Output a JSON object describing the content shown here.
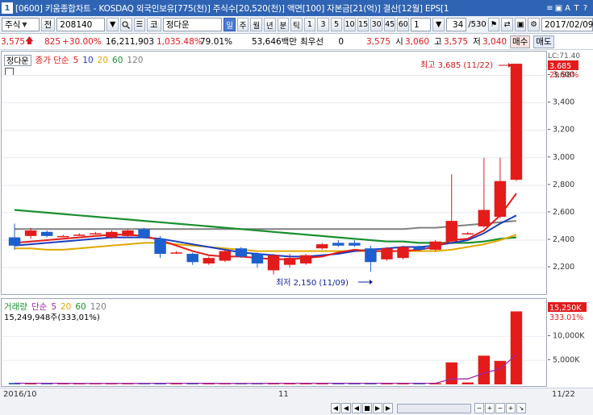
{
  "titlebar": {
    "window_number": "1",
    "title": "[0600] 키움종합차트 - KOSDAQ 외국인보유[775(천)] 주식수[20,520(천)] 액면[100] 자본금[21(억)] 결산[12월] EPS[1",
    "icons": [
      "menu-icon",
      "save-icon",
      "font-icon",
      "tool-icon",
      "help-icon"
    ],
    "icon_glyphs": [
      "≡",
      "▣",
      "A",
      "T",
      "?"
    ]
  },
  "toolbar": {
    "type_select": "주식",
    "prefix_btn": "전",
    "code": "208140",
    "market_btn": "코",
    "stock_name": "정다운",
    "periods": [
      "일",
      "주",
      "월",
      "년",
      "분",
      "틱"
    ],
    "period_active": "일",
    "nums": [
      "1",
      "3",
      "5",
      "10",
      "15",
      "30",
      "45",
      "60"
    ],
    "interval_value": "1",
    "page_counter": "34",
    "page_total": "/530",
    "date": "2017/02/09"
  },
  "infobar": {
    "price": "3,575",
    "change": "825",
    "change_rate": "+30.00%",
    "volume": "16,211,903",
    "volume_rate": "1,035.48%",
    "turnover": "79.01%",
    "amount": "53,646백만",
    "seller_label": "최우선",
    "seller_value": "0",
    "price2": "3,575",
    "open_label": "시",
    "open": "3,060",
    "high_label": "고",
    "high": "3,575",
    "low_label": "저",
    "low": "3,040",
    "buy_button": "매수",
    "sell_button": "매도"
  },
  "price_pane": {
    "name_button": "정다운",
    "legend_label": "종가 단순",
    "ma_periods": [
      "5",
      "10",
      "20",
      "60",
      "120"
    ],
    "ma_colors": [
      "#e31b1b",
      "#1c3fbf",
      "#e0a800",
      "#1a8f2e",
      "#808080"
    ],
    "high_annotation": "최고 3,685 (11/22)",
    "low_annotation": "최저 2,150 (11/09)",
    "last_price_tag": "3,685",
    "last_rate_tag": "29.98%",
    "axis_top_label": "LC:71.40"
  },
  "volume_pane": {
    "legend_label": "거래량",
    "legend_label2": "단순",
    "ma_periods": [
      "5",
      "20",
      "60",
      "120"
    ],
    "ma_colors": [
      "#9b2aa8",
      "#e0a800",
      "#1a8f2e",
      "#808080"
    ],
    "volume_text": "15,249,948주(333,01%)",
    "last_volume_tag": "15,250K",
    "last_volume_rate": "333.01%"
  },
  "date_labels": [
    "2016/10",
    "11",
    "11/22"
  ],
  "chart_data": {
    "type": "candlestick",
    "price_axis_ticks": [
      2200,
      2400,
      2600,
      2800,
      3000,
      3200,
      3400,
      3600
    ],
    "price_axis_labels": [
      "2,200",
      "2,400",
      "2,600",
      "2,800",
      "3,000",
      "3,200",
      "3,400",
      "3,600"
    ],
    "ylim": [
      2030,
      3750
    ],
    "candles": [
      {
        "o": 2420,
        "c": 2360,
        "h": 2520,
        "l": 2330
      },
      {
        "o": 2430,
        "c": 2470,
        "h": 2490,
        "l": 2410
      },
      {
        "o": 2460,
        "c": 2430,
        "h": 2470,
        "l": 2420
      },
      {
        "o": 2430,
        "c": 2430,
        "h": 2440,
        "l": 2420
      },
      {
        "o": 2440,
        "c": 2440,
        "h": 2450,
        "l": 2430
      },
      {
        "o": 2450,
        "c": 2450,
        "h": 2460,
        "l": 2440
      },
      {
        "o": 2420,
        "c": 2460,
        "h": 2470,
        "l": 2410
      },
      {
        "o": 2430,
        "c": 2470,
        "h": 2480,
        "l": 2420
      },
      {
        "o": 2480,
        "c": 2420,
        "h": 2490,
        "l": 2410
      },
      {
        "o": 2410,
        "c": 2300,
        "h": 2430,
        "l": 2270
      },
      {
        "o": 2310,
        "c": 2310,
        "h": 2320,
        "l": 2300
      },
      {
        "o": 2300,
        "c": 2240,
        "h": 2310,
        "l": 2220
      },
      {
        "o": 2230,
        "c": 2270,
        "h": 2280,
        "l": 2220
      },
      {
        "o": 2250,
        "c": 2320,
        "h": 2330,
        "l": 2240
      },
      {
        "o": 2340,
        "c": 2280,
        "h": 2350,
        "l": 2270
      },
      {
        "o": 2300,
        "c": 2230,
        "h": 2310,
        "l": 2200
      },
      {
        "o": 2180,
        "c": 2290,
        "h": 2300,
        "l": 2150
      },
      {
        "o": 2220,
        "c": 2270,
        "h": 2300,
        "l": 2200
      },
      {
        "o": 2230,
        "c": 2290,
        "h": 2300,
        "l": 2220
      },
      {
        "o": 2340,
        "c": 2370,
        "h": 2380,
        "l": 2330
      },
      {
        "o": 2380,
        "c": 2360,
        "h": 2400,
        "l": 2350
      },
      {
        "o": 2380,
        "c": 2360,
        "h": 2400,
        "l": 2350
      },
      {
        "o": 2340,
        "c": 2240,
        "h": 2360,
        "l": 2170
      },
      {
        "o": 2260,
        "c": 2340,
        "h": 2350,
        "l": 2250
      },
      {
        "o": 2270,
        "c": 2350,
        "h": 2360,
        "l": 2260
      },
      {
        "o": 2350,
        "c": 2330,
        "h": 2360,
        "l": 2320
      },
      {
        "o": 2330,
        "c": 2390,
        "h": 2400,
        "l": 2320
      },
      {
        "o": 2390,
        "c": 2540,
        "h": 2880,
        "l": 2370
      },
      {
        "o": 2450,
        "c": 2450,
        "h": 2460,
        "l": 2440
      },
      {
        "o": 2500,
        "c": 2620,
        "h": 3000,
        "l": 2490
      },
      {
        "o": 2570,
        "c": 2830,
        "h": 3000,
        "l": 2560
      },
      {
        "o": 2840,
        "c": 3685,
        "h": 3685,
        "l": 2830
      }
    ],
    "ma_lines": {
      "ma5": [
        2380,
        2390,
        2400,
        2410,
        2420,
        2430,
        2440,
        2440,
        2430,
        2400,
        2360,
        2320,
        2290,
        2280,
        2280,
        2270,
        2260,
        2260,
        2270,
        2280,
        2310,
        2330,
        2320,
        2320,
        2320,
        2330,
        2350,
        2400,
        2410,
        2470,
        2580,
        2740
      ],
      "ma10": [
        2360,
        2370,
        2380,
        2390,
        2400,
        2410,
        2420,
        2420,
        2420,
        2410,
        2390,
        2370,
        2350,
        2330,
        2310,
        2300,
        2290,
        2280,
        2280,
        2290,
        2300,
        2320,
        2330,
        2340,
        2350,
        2350,
        2360,
        2380,
        2400,
        2450,
        2520,
        2580
      ],
      "ma20": [
        2340,
        2340,
        2330,
        2330,
        2340,
        2350,
        2360,
        2370,
        2380,
        2380,
        2370,
        2360,
        2350,
        2340,
        2330,
        2320,
        2320,
        2320,
        2320,
        2320,
        2320,
        2320,
        2320,
        2320,
        2320,
        2320,
        2320,
        2330,
        2350,
        2370,
        2400,
        2440
      ],
      "ma60": [
        2620,
        2610,
        2600,
        2590,
        2580,
        2570,
        2560,
        2550,
        2540,
        2530,
        2520,
        2510,
        2500,
        2490,
        2480,
        2470,
        2460,
        2450,
        2440,
        2430,
        2420,
        2410,
        2400,
        2390,
        2390,
        2380,
        2380,
        2380,
        2380,
        2390,
        2410,
        2420
      ],
      "ma120": [
        2480,
        2480,
        2480,
        2480,
        2480,
        2480,
        2480,
        2480,
        2480,
        2480,
        2480,
        2480,
        2480,
        2480,
        2480,
        2480,
        2480,
        2480,
        2480,
        2480,
        2480,
        2480,
        2480,
        2480,
        2480,
        2490,
        2490,
        2500,
        2510,
        2520,
        2530,
        2540
      ]
    },
    "volume_axis_ticks": [
      5000,
      10000
    ],
    "volume_axis_labels": [
      "5,000K",
      "10,000K"
    ],
    "volume_ylim": [
      0,
      16500
    ],
    "volumes": [
      300,
      250,
      220,
      200,
      180,
      190,
      200,
      210,
      260,
      280,
      220,
      200,
      190,
      200,
      210,
      240,
      260,
      220,
      210,
      230,
      220,
      210,
      280,
      240,
      230,
      210,
      250,
      4600,
      400,
      6000,
      4900,
      15250
    ],
    "volume_ma5": [
      250,
      240,
      230,
      220,
      210,
      200,
      200,
      200,
      210,
      230,
      240,
      230,
      220,
      210,
      200,
      210,
      220,
      230,
      230,
      230,
      230,
      220,
      230,
      240,
      240,
      240,
      240,
      1130,
      1150,
      2340,
      3230,
      6230
    ]
  }
}
